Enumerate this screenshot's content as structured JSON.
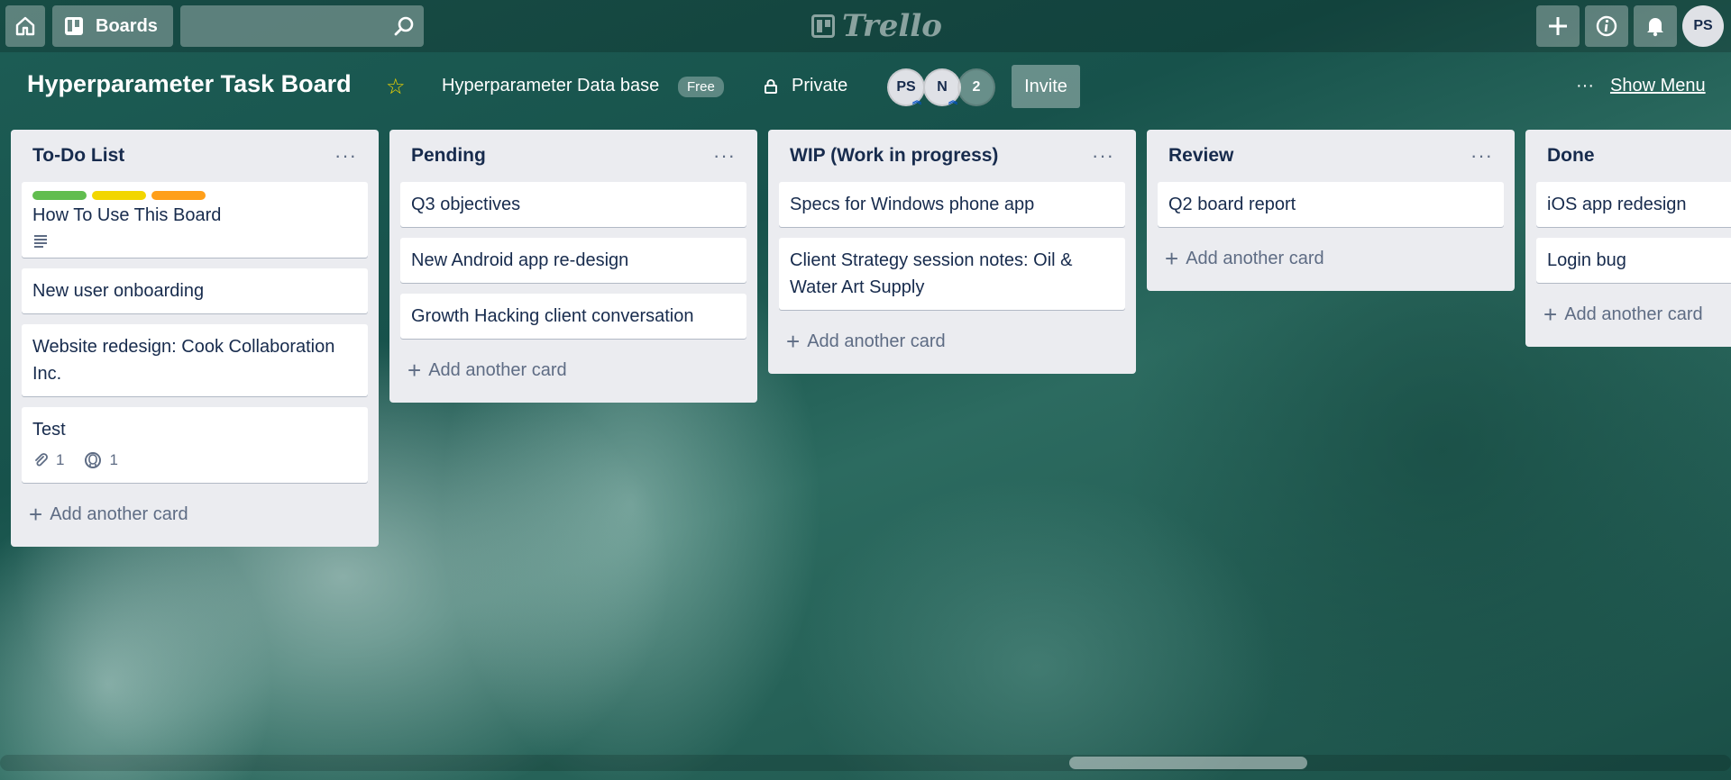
{
  "topbar": {
    "home_icon": "home-icon",
    "boards_label": "Boards",
    "search_icon": "search-icon",
    "logo_text": "Trello",
    "plus_icon": "plus-icon",
    "info_icon": "info-icon",
    "bell_icon": "bell-icon",
    "avatar": "PS"
  },
  "board": {
    "title": "Hyperparameter Task Board",
    "workspace": "Hyperparameter Data base",
    "plan_badge": "Free",
    "visibility": "Private",
    "members": [
      "PS",
      "N"
    ],
    "extra_members": "2",
    "invite_label": "Invite",
    "show_menu_label": "Show Menu"
  },
  "lists": [
    {
      "title": "To-Do List",
      "cards": [
        {
          "title": "How To Use This Board",
          "labels": [
            "#61bd4f",
            "#f2d600",
            "#ff9f1a"
          ],
          "has_description": true
        },
        {
          "title": "New user onboarding"
        },
        {
          "title": "Website redesign: Cook Collaboration Inc."
        },
        {
          "title": "Test",
          "attachments": "1",
          "github": "1"
        }
      ],
      "add_label": "Add another card"
    },
    {
      "title": "Pending",
      "cards": [
        {
          "title": "Q3 objectives"
        },
        {
          "title": "New Android app re-design"
        },
        {
          "title": "Growth Hacking client conversation"
        }
      ],
      "add_label": "Add another card"
    },
    {
      "title": "WIP (Work in progress)",
      "cards": [
        {
          "title": "Specs for Windows phone app"
        },
        {
          "title": "Client Strategy session notes: Oil & Water Art Supply"
        }
      ],
      "add_label": "Add another card"
    },
    {
      "title": "Review",
      "cards": [
        {
          "title": "Q2 board report"
        }
      ],
      "add_label": "Add another card"
    },
    {
      "title": "Done",
      "cards": [
        {
          "title": "iOS app redesign"
        },
        {
          "title": "Login bug"
        }
      ],
      "add_label": "Add another card"
    }
  ]
}
